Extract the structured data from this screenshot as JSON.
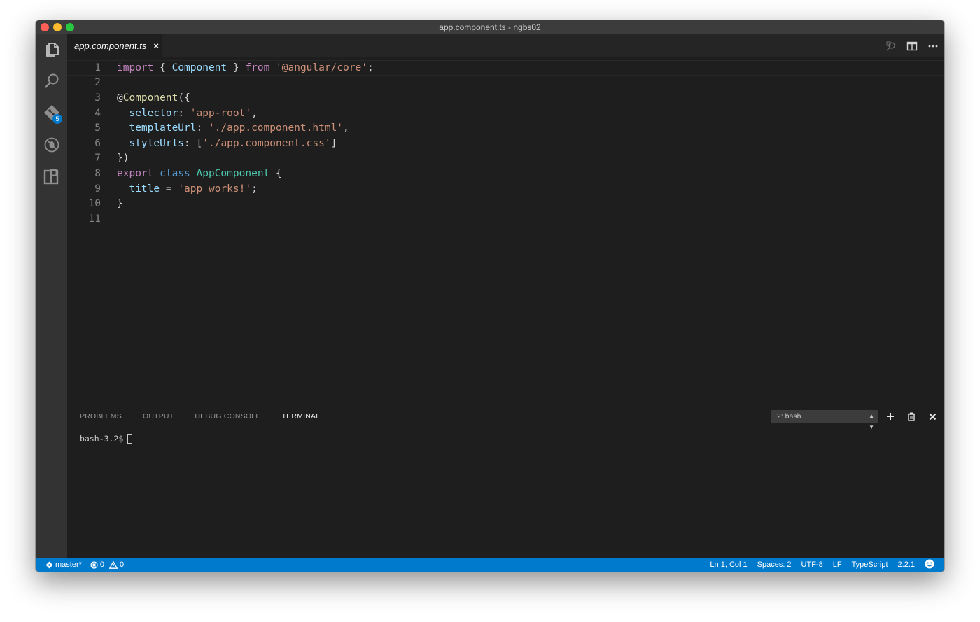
{
  "window": {
    "title": "app.component.ts - ngbs02"
  },
  "activity_bar": {
    "scm_badge": "5"
  },
  "tab": {
    "label": "app.component.ts",
    "close_glyph": "×"
  },
  "editor": {
    "language_colors": {
      "keyword": "#c586c0",
      "storage": "#569cd6",
      "string": "#ce9178",
      "property": "#9cdcfe",
      "class": "#4ec9b0",
      "function": "#dcdcaa"
    },
    "lines": [
      {
        "n": "1",
        "t": [
          [
            "kw",
            "import"
          ],
          [
            "pl",
            " { "
          ],
          [
            "prop",
            "Component"
          ],
          [
            "pl",
            " } "
          ],
          [
            "kw",
            "from"
          ],
          [
            "pl",
            " "
          ],
          [
            "str",
            "'@angular/core'"
          ],
          [
            "pl",
            ";"
          ]
        ]
      },
      {
        "n": "2",
        "t": []
      },
      {
        "n": "3",
        "t": [
          [
            "pl",
            "@"
          ],
          [
            "fn",
            "Component"
          ],
          [
            "pl",
            "({"
          ]
        ]
      },
      {
        "n": "4",
        "t": [
          [
            "pl",
            "  "
          ],
          [
            "prop",
            "selector"
          ],
          [
            "pl",
            ": "
          ],
          [
            "str",
            "'app-root'"
          ],
          [
            "pl",
            ","
          ]
        ]
      },
      {
        "n": "5",
        "t": [
          [
            "pl",
            "  "
          ],
          [
            "prop",
            "templateUrl"
          ],
          [
            "pl",
            ": "
          ],
          [
            "str",
            "'./app.component.html'"
          ],
          [
            "pl",
            ","
          ]
        ]
      },
      {
        "n": "6",
        "t": [
          [
            "pl",
            "  "
          ],
          [
            "prop",
            "styleUrls"
          ],
          [
            "pl",
            ": ["
          ],
          [
            "str",
            "'./app.component.css'"
          ],
          [
            "pl",
            "]"
          ]
        ]
      },
      {
        "n": "7",
        "t": [
          [
            "pl",
            "})"
          ]
        ]
      },
      {
        "n": "8",
        "t": [
          [
            "kw",
            "export"
          ],
          [
            "pl",
            " "
          ],
          [
            "kw2",
            "class"
          ],
          [
            "pl",
            " "
          ],
          [
            "cls",
            "AppComponent"
          ],
          [
            "pl",
            " {"
          ]
        ]
      },
      {
        "n": "9",
        "t": [
          [
            "pl",
            "  "
          ],
          [
            "prop",
            "title"
          ],
          [
            "pl",
            " = "
          ],
          [
            "str",
            "'app works!'"
          ],
          [
            "pl",
            ";"
          ]
        ]
      },
      {
        "n": "10",
        "t": [
          [
            "pl",
            "}"
          ]
        ]
      },
      {
        "n": "11",
        "t": []
      }
    ]
  },
  "panel": {
    "tabs": [
      {
        "label": "PROBLEMS",
        "active": false
      },
      {
        "label": "OUTPUT",
        "active": false
      },
      {
        "label": "DEBUG CONSOLE",
        "active": false
      },
      {
        "label": "TERMINAL",
        "active": true
      }
    ],
    "terminal_select": "2: bash",
    "terminal_prompt": "bash-3.2$"
  },
  "status_bar": {
    "branch": "master*",
    "errors": "0",
    "warnings": "0",
    "cursor_position": "Ln 1, Col 1",
    "indentation": "Spaces: 2",
    "encoding": "UTF-8",
    "eol": "LF",
    "language": "TypeScript",
    "ts_version": "2.2.1"
  },
  "colors": {
    "accent": "#007acc",
    "background": "#1e1e1e",
    "activity_bar": "#333333",
    "title_bar": "#3c3c3c"
  }
}
